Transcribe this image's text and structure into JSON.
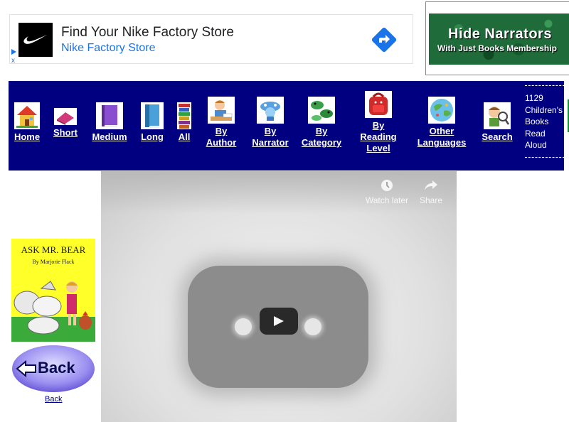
{
  "ad": {
    "headline": "Find Your Nike Factory Store",
    "advertiser": "Nike Factory Store",
    "logo_icon": "nike-swoosh-icon",
    "arrow_icon": "directions-arrow-icon",
    "accent_color": "#1a73e8"
  },
  "narrators_banner": {
    "line1": "Hide Narrators",
    "line2": "With Just Books Membership"
  },
  "nav": {
    "background": "#000080",
    "items": [
      {
        "label": "Home",
        "icon": "house-icon"
      },
      {
        "label": "Short",
        "icon": "thin-book-icon"
      },
      {
        "label": "Medium",
        "icon": "medium-book-icon"
      },
      {
        "label": "Long",
        "icon": "thick-book-icon"
      },
      {
        "label": "All",
        "icon": "book-stack-icon"
      },
      {
        "label_lines": [
          "By",
          "Author"
        ],
        "icon": "author-writing-icon"
      },
      {
        "label_lines": [
          "By",
          "Narrator"
        ],
        "icon": "narrator-icon"
      },
      {
        "label_lines": [
          "By",
          "Category"
        ],
        "icon": "animals-icon"
      },
      {
        "label_lines": [
          "By",
          "Reading",
          "Level"
        ],
        "icon": "backpack-icon"
      },
      {
        "label_lines": [
          "Other",
          "Languages"
        ],
        "icon": "globe-icon"
      },
      {
        "label": "Search",
        "icon": "magnifier-boy-icon"
      }
    ],
    "count_lines": [
      "1129",
      "Children's",
      "Books",
      "Read",
      "Aloud"
    ]
  },
  "video": {
    "watch_later": "Watch later",
    "share": "Share",
    "play_icon": "play-icon"
  },
  "book": {
    "title": "ASK MR. BEAR",
    "author": "By Marjorie Flack"
  },
  "back": {
    "button_label": "Back",
    "link_label": "Back"
  }
}
